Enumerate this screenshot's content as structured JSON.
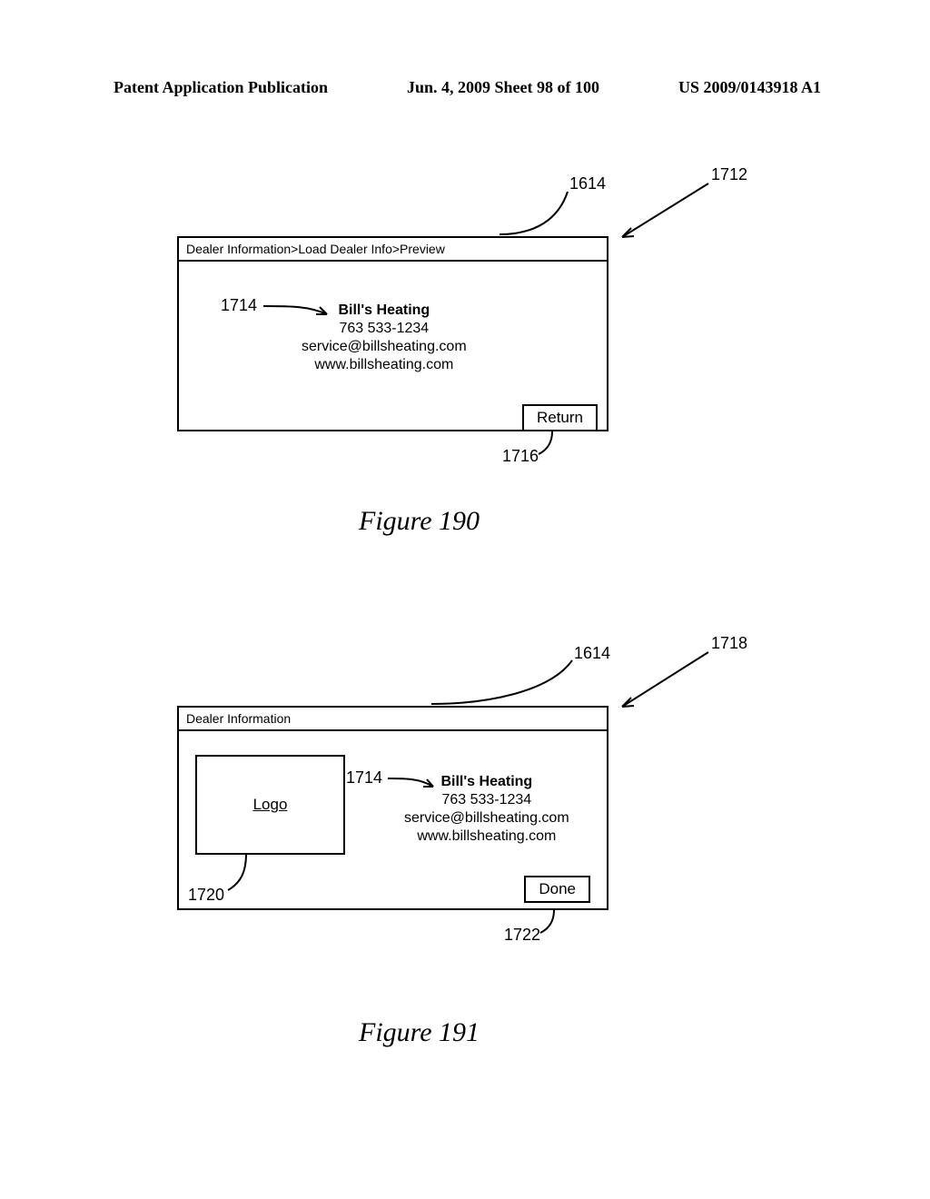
{
  "header": {
    "left": "Patent Application Publication",
    "center": "Jun. 4, 2009  Sheet 98 of 100",
    "right": "US 2009/0143918 A1"
  },
  "fig190": {
    "breadcrumb": "Dealer Information>Load Dealer Info>Preview",
    "dealer": {
      "name": "Bill's Heating",
      "phone": "763 533-1234",
      "email": "service@billsheating.com",
      "web": "www.billsheating.com"
    },
    "button": "Return",
    "caption": "Figure 190",
    "refs": {
      "figure": "1712",
      "header": "1614",
      "info": "1714",
      "button": "1716"
    }
  },
  "fig191": {
    "breadcrumb": "Dealer Information",
    "logo_label": "Logo",
    "dealer": {
      "name": "Bill's Heating",
      "phone": "763 533-1234",
      "email": "service@billsheating.com",
      "web": "www.billsheating.com"
    },
    "button": "Done",
    "caption": "Figure 191",
    "refs": {
      "figure": "1718",
      "header": "1614",
      "info": "1714",
      "logo": "1720",
      "button": "1722"
    }
  }
}
